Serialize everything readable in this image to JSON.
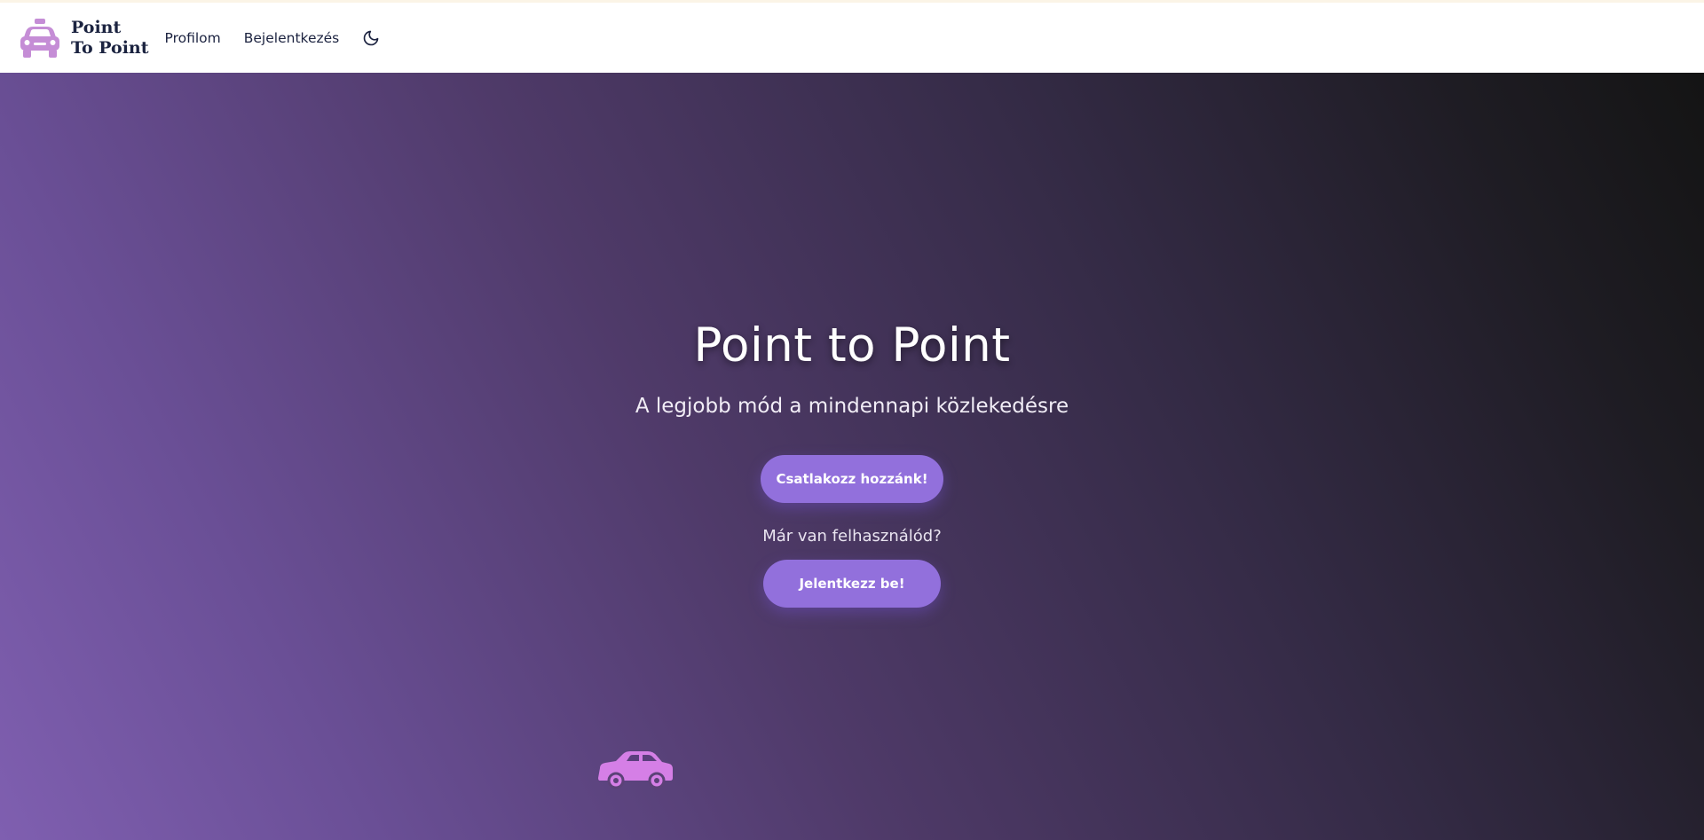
{
  "brand": {
    "line1": "Point",
    "line2": "To Point",
    "icon": "taxi-icon",
    "icon_color": "#c58dd6"
  },
  "nav": {
    "profile_label": "Profilom",
    "login_label": "Bejelentkezés",
    "theme_icon": "moon-icon"
  },
  "hero": {
    "title": "Point to Point",
    "subtitle": "A legjobb mód a mindennapi közlekedésre",
    "join_button": "Csatlakozz hozzánk!",
    "already_text": "Már van felhasználód?",
    "login_button": "Jelentkezz be!",
    "car_icon": "car-icon",
    "car_color": "#d57fe6",
    "button_color": "#9270dc"
  }
}
